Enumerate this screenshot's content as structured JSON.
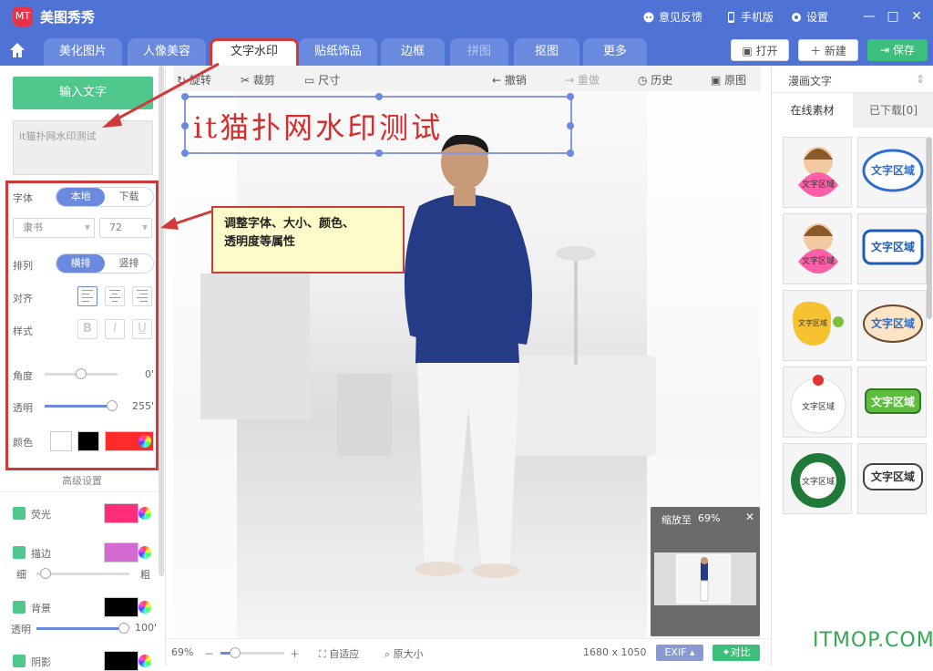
{
  "app": {
    "logo_text": "MT",
    "title": "美图秀秀"
  },
  "titlebar": {
    "feedback": "意见反馈",
    "mobile": "手机版",
    "settings": "设置"
  },
  "tabs": [
    {
      "label": "美化图片"
    },
    {
      "label": "人像美容"
    },
    {
      "label": "文字水印",
      "active": true
    },
    {
      "label": "贴纸饰品"
    },
    {
      "label": "边框"
    },
    {
      "label": "拼图",
      "disabled": true
    },
    {
      "label": "抠图"
    },
    {
      "label": "更多"
    }
  ],
  "actions": {
    "open": "打开",
    "new": "新建",
    "save": "保存"
  },
  "left": {
    "input_button": "输入文字",
    "text_value": "it猫扑网水印测试",
    "font_label": "字体",
    "font_local": "本地",
    "font_download": "下载",
    "font_name": "隶书",
    "font_size": "72",
    "layout_label": "排列",
    "layout_h": "横排",
    "layout_v": "竖排",
    "align_label": "对齐",
    "style_label": "样式",
    "style_b": "B",
    "style_i": "I",
    "style_u": "U",
    "angle_label": "角度",
    "angle_value": "0'",
    "opacity_label": "透明",
    "opacity_value": "255'",
    "color_label": "颜色",
    "advanced": "高级设置",
    "glow": "荧光",
    "stroke": "描边",
    "thin": "细",
    "thick": "粗",
    "background": "背景",
    "bg_opacity_label": "透明",
    "bg_opacity_value": "100'",
    "shadow": "阴影"
  },
  "toolbar": {
    "rotate": "旋转",
    "crop": "裁剪",
    "size": "尺寸",
    "undo": "撤销",
    "redo": "重做",
    "history": "历史",
    "original": "原图"
  },
  "watermark_text": "it猫扑网水印测试",
  "callout": {
    "line1": "调整字体、大小、颜色、",
    "line2": "透明度等属性"
  },
  "zoom_panel": {
    "label": "缩放至",
    "value": "69%"
  },
  "status": {
    "zoom": "69%",
    "fit": "自适应",
    "actual": "原大小",
    "dimensions": "1680 x 1050",
    "exif": "EXIF",
    "compare": "对比"
  },
  "right": {
    "header": "漫画文字",
    "tab_online": "在线素材",
    "tab_downloaded": "已下载[0]",
    "sticker_text": "文字区域"
  },
  "colors": {
    "accent": "#4e73d4",
    "green": "#50c88d",
    "red": "#d23a3a",
    "text_color": "#ff2222",
    "glow": "#ff2d7a",
    "stroke": "#d46ad4"
  },
  "site_watermark": "ITMOP.COM"
}
